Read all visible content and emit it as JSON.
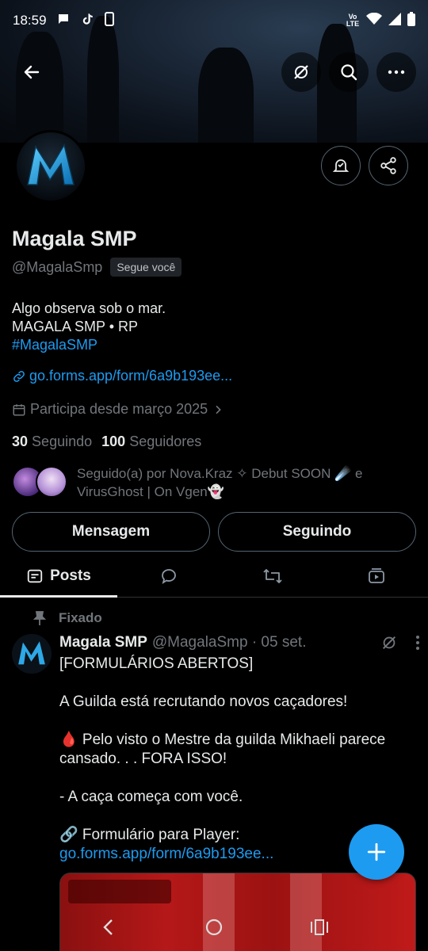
{
  "status_bar": {
    "time": "18:59",
    "network_label": "Vo LTE"
  },
  "profile": {
    "name": "Magala SMP",
    "handle": "@MagalaSmp",
    "follows_you_badge": "Segue você",
    "bio": [
      "Algo observa sob o mar.",
      "MAGALA SMP • RP"
    ],
    "hashtag": "#MagalaSMP",
    "link": "go.forms.app/form/6a9b193ee...",
    "joined": "Participa desde março 2025",
    "following_count": "30",
    "following_label": "Seguindo",
    "followers_count": "100",
    "followers_label": "Seguidores",
    "followed_by": "Seguido(a) por Nova.Kraz ✧ Debut SOON ☄️ e VirusGhost | On Vgen👻"
  },
  "buttons": {
    "message": "Mensagem",
    "following": "Seguindo"
  },
  "tabs": [
    {
      "label": "Posts",
      "icon": "posts-icon",
      "active": true
    },
    {
      "label": "",
      "icon": "replies-icon",
      "active": false
    },
    {
      "label": "",
      "icon": "retweet-icon",
      "active": false
    },
    {
      "label": "",
      "icon": "media-icon",
      "active": false
    }
  ],
  "post": {
    "pinned_label": "Fixado",
    "author_name": "Magala SMP",
    "meta": "@MagalaSmp · 05 set.",
    "lines": [
      "[FORMULÁRIOS ABERTOS]",
      "",
      "A Guilda está recrutando novos caçadores!",
      "",
      "🩸 Pelo visto o Mestre da guilda Mikhaeli parece cansado. . . FORA ISSO!",
      "",
      "- A caça começa com você.",
      "",
      "🔗  Formulário para Player:"
    ],
    "link": "go.forms.app/form/6a9b193ee..."
  },
  "colors": {
    "accent": "#1d9bf0",
    "text": "#e7e9ea",
    "muted": "#71767b",
    "border": "#536471",
    "background": "#000000"
  }
}
